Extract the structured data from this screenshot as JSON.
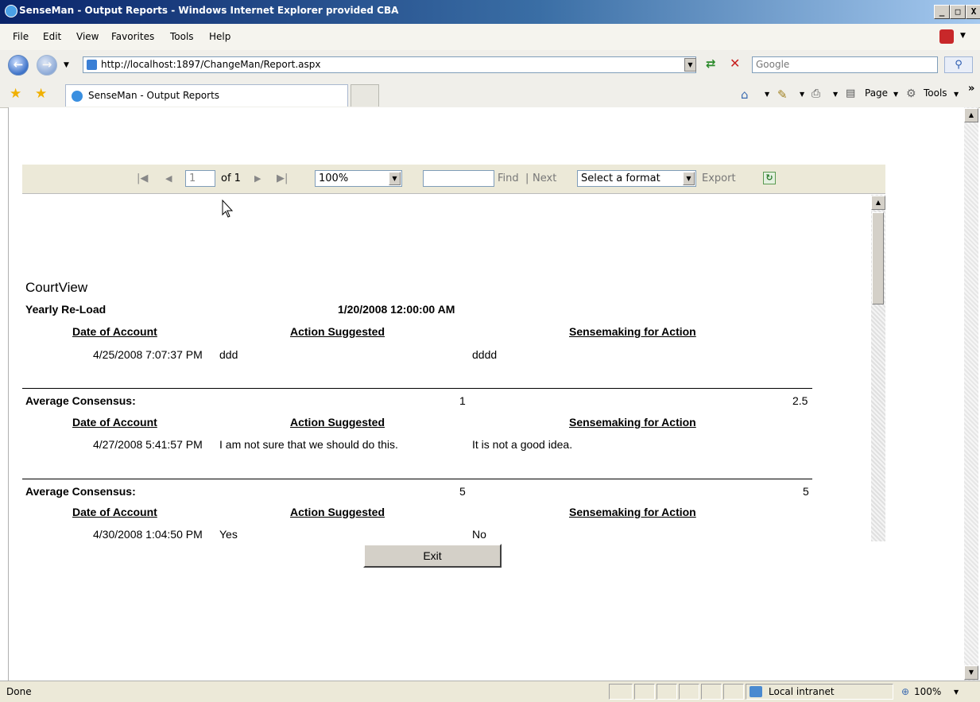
{
  "window": {
    "title": "SenseMan - Output Reports - Windows Internet Explorer provided CBA"
  },
  "menu": [
    "File",
    "Edit",
    "View",
    "Favorites",
    "Tools",
    "Help"
  ],
  "address": {
    "url": "http://localhost:1897/ChangeMan/Report.aspx",
    "search_placeholder": "Google"
  },
  "tab": {
    "label": "SenseMan - Output Reports"
  },
  "command_bar": {
    "page": "Page",
    "tools": "Tools"
  },
  "report_toolbar": {
    "page_current": "1",
    "page_of": "of 1",
    "zoom": "100%",
    "find_value": "",
    "find": "Find",
    "separator": "|",
    "next": "Next",
    "format": "Select a format",
    "export": "Export"
  },
  "report": {
    "header": {
      "org": "CourtView",
      "title": "Yearly Re-Load",
      "date": "1/20/2008 12:00:00 AM"
    },
    "columns": [
      "Date of Account",
      "Action Suggested",
      "Sensemaking for Action"
    ],
    "groups": [
      {
        "rows": [
          {
            "date": "4/25/2008 7:07:37 PM",
            "action": "ddd",
            "sensemaking": "dddd"
          }
        ],
        "consensus": {
          "label": "Average Consensus:",
          "value1": "1",
          "value2": "2.5"
        }
      },
      {
        "rows": [
          {
            "date": "4/27/2008 5:41:57 PM",
            "action": "I am not sure that we should do this.",
            "sensemaking": "It is not a good idea."
          }
        ],
        "consensus": {
          "label": "Average Consensus:",
          "value1": "5",
          "value2": "5"
        }
      },
      {
        "rows": [
          {
            "date": "4/30/2008 1:04:50 PM",
            "action": "Yes",
            "sensemaking": "No"
          }
        ]
      }
    ]
  },
  "exit_button": "Exit",
  "status": {
    "text": "Done",
    "zone": "Local intranet",
    "zoom": "100%"
  }
}
